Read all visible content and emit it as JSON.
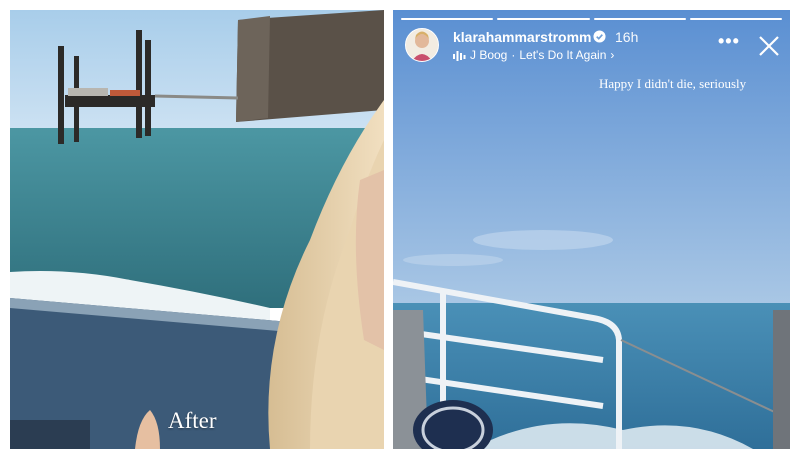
{
  "left_panel": {
    "caption": "After"
  },
  "story": {
    "progress_segments": 4,
    "active_segment": 4,
    "username": "klarahammarstromm",
    "verified": true,
    "time_ago": "16h",
    "music": {
      "artist": "J Boog",
      "separator": "·",
      "song": "Let's Do It Again",
      "chevron": "›"
    },
    "more_options": "•••",
    "caption": "Happy I didn't die, seriously"
  },
  "icons": {
    "verified": "verified-badge-icon",
    "music": "music-bars-icon",
    "more": "more-options-icon",
    "close": "close-icon"
  },
  "colors": {
    "sky_left": "#b7d6ee",
    "sea_left": "#3f8a93",
    "sky_right": "#6e9ed6",
    "sea_right": "#3c84ad",
    "boat_rail": "#3c5a78"
  }
}
